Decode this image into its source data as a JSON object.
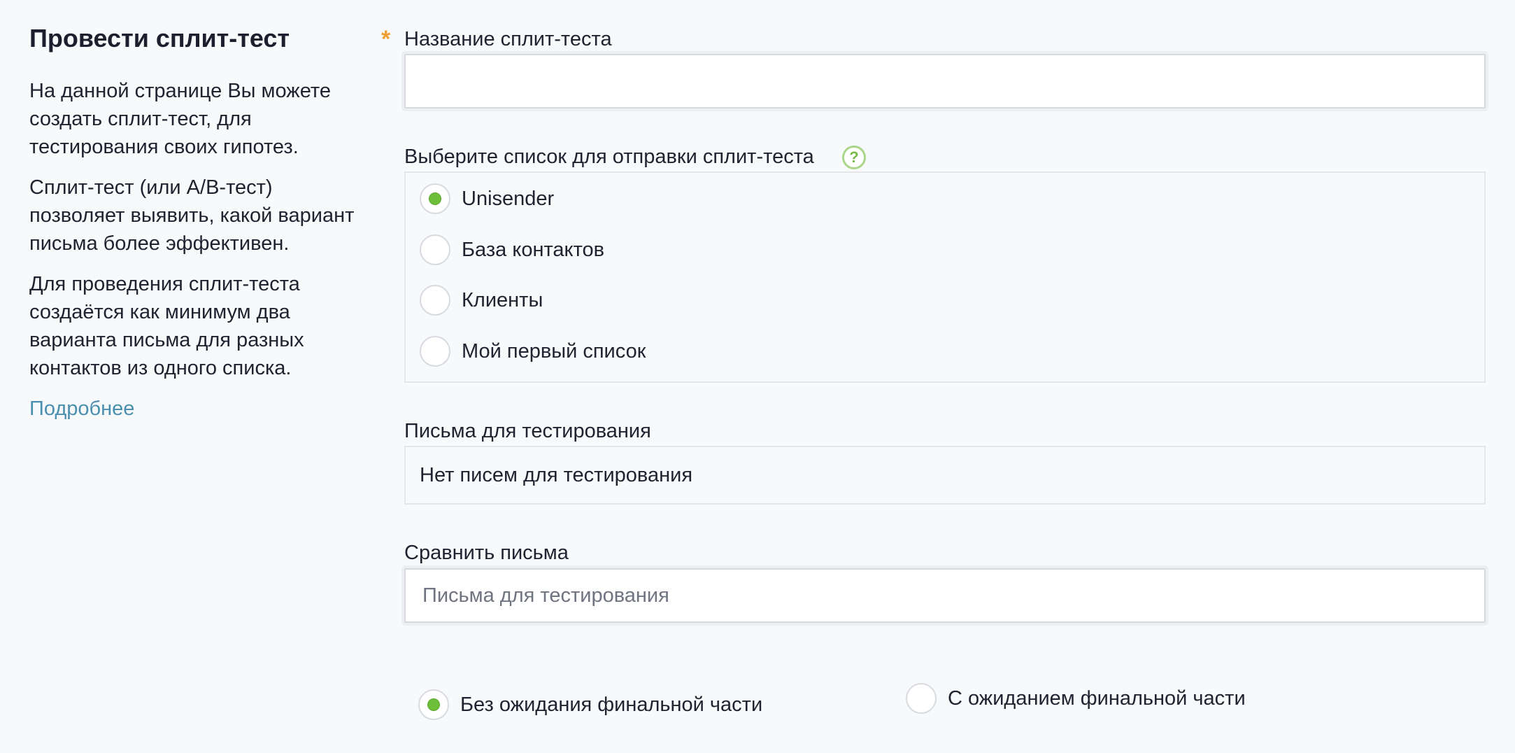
{
  "sidebar": {
    "title": "Провести сплит-тест",
    "paragraphs": [
      "На данной странице Вы можете создать сплит-тест, для тестирования своих гипотез.",
      "Сплит-тест (или A/B-тест) позволяет выявить, какой вариант письма более эффективен.",
      "Для проведения сплит-теста создаётся как минимум два варианта письма для разных контактов из одного списка."
    ],
    "more_link": "Подробнее"
  },
  "form": {
    "name_field": {
      "required_mark": "*",
      "label": "Название сплит-теста",
      "value": "",
      "placeholder": ""
    },
    "list_field": {
      "label": "Выберите список для отправки сплит-теста",
      "help_icon": "?",
      "options": [
        {
          "label": "Unisender",
          "checked": true
        },
        {
          "label": "База контактов",
          "checked": false
        },
        {
          "label": "Клиенты",
          "checked": false
        },
        {
          "label": "Мой первый список",
          "checked": false
        }
      ]
    },
    "letters_field": {
      "label": "Письма для тестирования",
      "empty_text": "Нет писем для тестирования"
    },
    "compare_field": {
      "label": "Сравнить письма",
      "placeholder": "Письма для тестирования"
    },
    "mode": {
      "options": [
        {
          "label": "Без ожидания финальной части",
          "checked": true
        },
        {
          "label": "С ожиданием финальной части",
          "checked": false
        }
      ]
    }
  },
  "colors": {
    "accent_green": "#6dbf3a",
    "link": "#4a8fb0",
    "required_star": "#f0a030"
  },
  "icons": {
    "help": "question-circle-icon"
  }
}
